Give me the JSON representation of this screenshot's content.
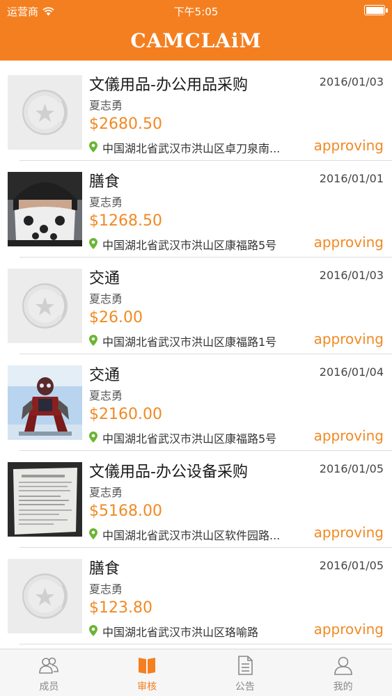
{
  "status_bar": {
    "carrier": "运营商",
    "time": "下午5:05"
  },
  "app": {
    "title": "CAMCLAiM"
  },
  "colors": {
    "brand": "#f47f20",
    "amount": "#f08a24",
    "location_pin": "#6bb535"
  },
  "claims": [
    {
      "title": "文儀用品-办公用品采购",
      "date": "2016/01/03",
      "person": "夏志勇",
      "amount": "$2680.50",
      "location": "中国湖北省武汉市洪山区卓刀泉南...",
      "status": "approving",
      "thumbnail": "placeholder-logo"
    },
    {
      "title": "膳食",
      "date": "2016/01/01",
      "person": "夏志勇",
      "amount": "$1268.50",
      "location": "中国湖北省武汉市洪山区康福路5号",
      "status": "approving",
      "thumbnail": "photo-person-mask"
    },
    {
      "title": "交通",
      "date": "2016/01/03",
      "person": "夏志勇",
      "amount": "$26.00",
      "location": "中国湖北省武汉市洪山区康福路1号",
      "status": "approving",
      "thumbnail": "placeholder-logo"
    },
    {
      "title": "交通",
      "date": "2016/01/04",
      "person": "夏志勇",
      "amount": "$2160.00",
      "location": "中国湖北省武汉市洪山区康福路5号",
      "status": "approving",
      "thumbnail": "photo-robot-figure"
    },
    {
      "title": "文儀用品-办公设备采购",
      "date": "2016/01/05",
      "person": "夏志勇",
      "amount": "$5168.00",
      "location": "中国湖北省武汉市洪山区软件园路...",
      "status": "approving",
      "thumbnail": "photo-receipt"
    },
    {
      "title": "膳食",
      "date": "2016/01/05",
      "person": "夏志勇",
      "amount": "$123.80",
      "location": "中国湖北省武汉市洪山区珞喻路",
      "status": "approving",
      "thumbnail": "placeholder-logo"
    }
  ],
  "tabs": [
    {
      "label": "成员",
      "icon": "members-icon",
      "active": false
    },
    {
      "label": "审核",
      "icon": "review-icon",
      "active": true
    },
    {
      "label": "公告",
      "icon": "notice-icon",
      "active": false
    },
    {
      "label": "我的",
      "icon": "profile-icon",
      "active": false
    }
  ]
}
